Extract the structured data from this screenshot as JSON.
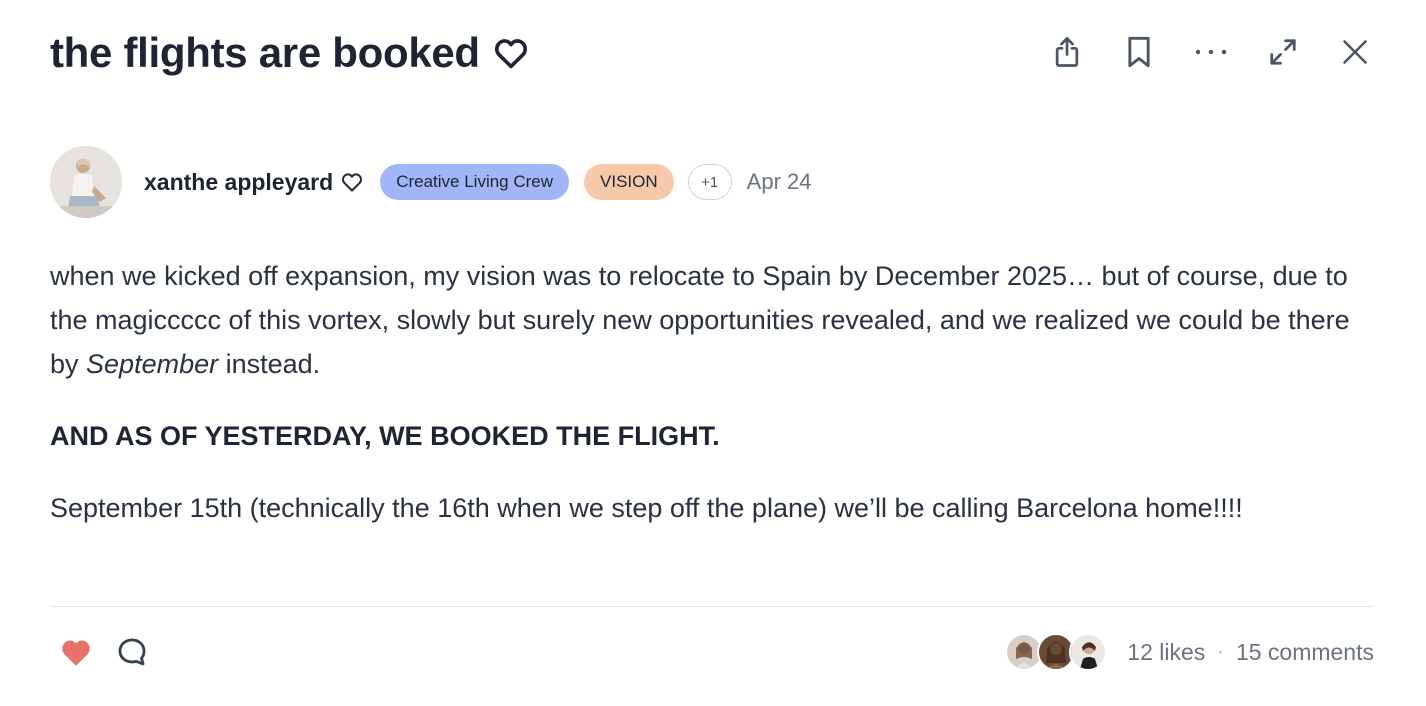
{
  "post": {
    "title": "the flights are booked",
    "author": "xanthe appleyard",
    "tags": [
      {
        "label": "Creative Living Crew",
        "color": "#a1b6f7"
      },
      {
        "label": "VISION",
        "color": "#f7c9a8"
      }
    ],
    "more_tags": "+1",
    "date": "Apr 24",
    "body": {
      "p1_before": "when we kicked off expansion, my vision was to relocate to Spain by December 2025… but of course, due to the magiccccc of this vortex, slowly but surely new opportunities revealed, and we realized we could be there by ",
      "p1_italic": "September",
      "p1_after": " instead.",
      "p2": "AND AS OF YESTERDAY, WE BOOKED THE FLIGHT.",
      "p3": "September 15th (technically the 16th when we step off the plane) we’ll be calling Barcelona home!!!!"
    }
  },
  "toolbar": {
    "icons": [
      "share-icon",
      "bookmark-icon",
      "more-icon",
      "expand-icon",
      "close-icon"
    ]
  },
  "footer": {
    "likes": "12 likes",
    "separator": "·",
    "comments": "15 comments",
    "liked": true,
    "like_color": "#e8716b"
  }
}
